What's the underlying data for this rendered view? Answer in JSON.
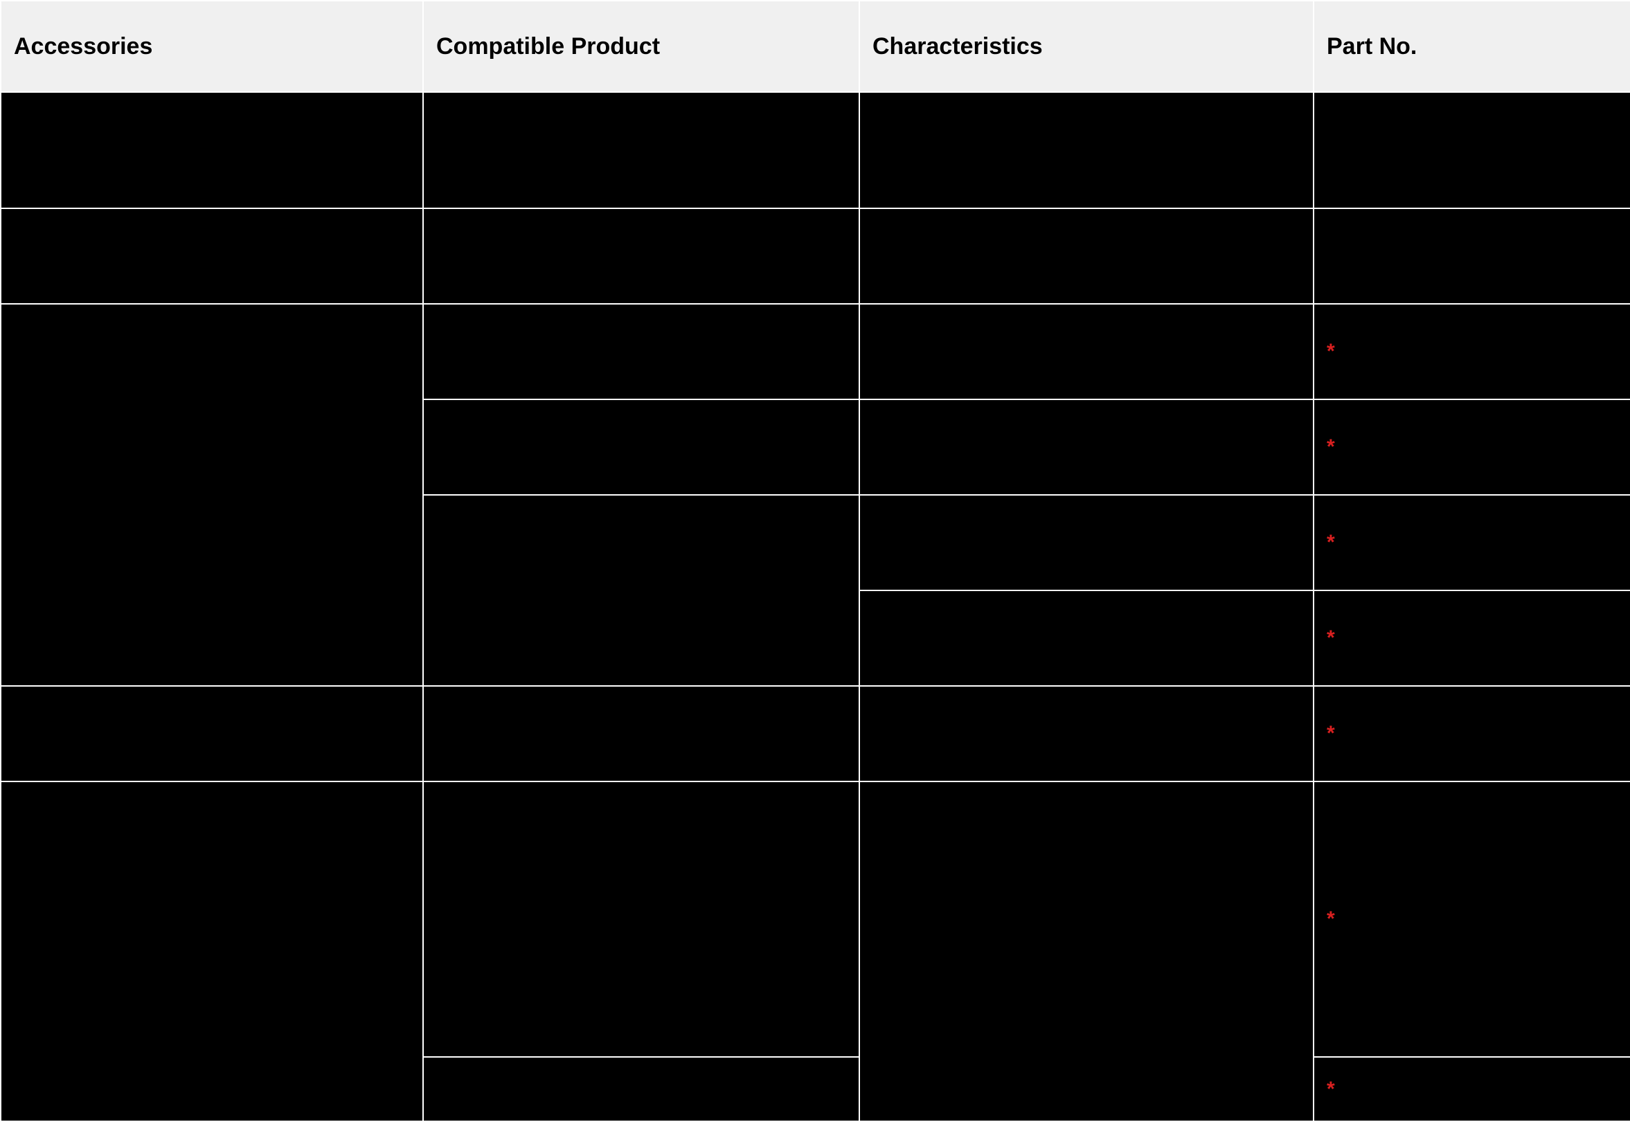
{
  "table": {
    "headers": {
      "accessories": "Accessories",
      "compatible_product": "Compatible Product",
      "characteristics": "Characteristics",
      "part_no": "Part No."
    },
    "rows": [
      {
        "accessories": "",
        "compatible_product": "",
        "characteristics": "",
        "part_no": "",
        "has_star": false,
        "height": "h-tall"
      },
      {
        "accessories": "",
        "compatible_product": "",
        "characteristics": "",
        "part_no": "",
        "has_star": false,
        "height": "h-med"
      },
      {
        "accessories": "",
        "accessories_rowspan": 4,
        "compatible_product": "",
        "characteristics": "",
        "part_no": "",
        "has_star": true,
        "height": "h-med"
      },
      {
        "compatible_product": "",
        "characteristics": "",
        "part_no": "",
        "has_star": true,
        "height": "h-med"
      },
      {
        "compatible_product": "",
        "compatible_product_rowspan": 2,
        "characteristics": "",
        "part_no": "",
        "has_star": true,
        "height": "h-med"
      },
      {
        "characteristics": "",
        "part_no": "",
        "has_star": true,
        "height": "h-med"
      },
      {
        "accessories": "",
        "compatible_product": "",
        "characteristics": "",
        "part_no": "",
        "has_star": true,
        "height": "h-med"
      },
      {
        "accessories": "",
        "accessories_rowspan": 2,
        "compatible_product": "",
        "characteristics": "",
        "characteristics_rowspan": 2,
        "part_no": "",
        "has_star": true,
        "height": "h-big"
      },
      {
        "compatible_product": "",
        "part_no": "",
        "has_star": true,
        "height": "h-last"
      }
    ],
    "star_glyph": "*"
  }
}
